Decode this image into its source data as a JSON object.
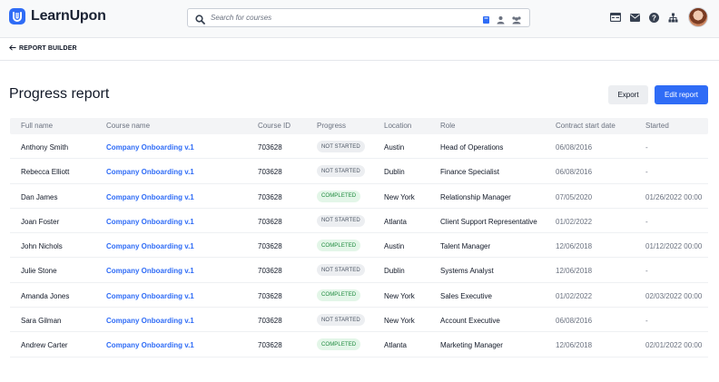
{
  "brand": {
    "name": "LearnUpon",
    "accent": "#2f6cf6"
  },
  "search": {
    "placeholder": "Search for courses",
    "value": "",
    "filter_icons": [
      "course-filter-icon",
      "user-filter-icon",
      "group-filter-icon"
    ]
  },
  "header_icons": [
    "catalog-icon",
    "mail-icon",
    "help-icon",
    "org-chart-icon",
    "avatar"
  ],
  "breadcrumb": {
    "back_label": "REPORT BUILDER"
  },
  "page": {
    "title": "Progress report",
    "export_label": "Export",
    "edit_label": "Edit report"
  },
  "table": {
    "columns": [
      "Full name",
      "Course name",
      "Course ID",
      "Progress",
      "Location",
      "Role",
      "Contract start date",
      "Started"
    ],
    "rows": [
      {
        "name": "Anthony Smith",
        "course": "Company Onboarding v.1",
        "id": "703628",
        "progress": "NOT STARTED",
        "status": "not",
        "location": "Austin",
        "role": "Head of Operations",
        "contract": "06/08/2016",
        "started": "-"
      },
      {
        "name": "Rebecca Elliott",
        "course": "Company Onboarding v.1",
        "id": "703628",
        "progress": "NOT STARTED",
        "status": "not",
        "location": "Dublin",
        "role": "Finance Specialist",
        "contract": "06/08/2016",
        "started": "-"
      },
      {
        "name": "Dan James",
        "course": "Company Onboarding v.1",
        "id": "703628",
        "progress": "COMPLETED",
        "status": "done",
        "location": "New York",
        "role": "Relationship Manager",
        "contract": "07/05/2020",
        "started": "01/26/2022 00:00"
      },
      {
        "name": "Joan Foster",
        "course": "Company Onboarding v.1",
        "id": "703628",
        "progress": "NOT STARTED",
        "status": "not",
        "location": "Atlanta",
        "role": "Client Support Representative",
        "contract": "01/02/2022",
        "started": "-"
      },
      {
        "name": "John Nichols",
        "course": "Company Onboarding v.1",
        "id": "703628",
        "progress": "COMPLETED",
        "status": "done",
        "location": "Austin",
        "role": "Talent Manager",
        "contract": "12/06/2018",
        "started": "01/12/2022 00:00"
      },
      {
        "name": "Julie Stone",
        "course": "Company Onboarding v.1",
        "id": "703628",
        "progress": "NOT STARTED",
        "status": "not",
        "location": "Dublin",
        "role": "Systems Analyst",
        "contract": "12/06/2018",
        "started": "-"
      },
      {
        "name": "Amanda Jones",
        "course": "Company Onboarding v.1",
        "id": "703628",
        "progress": "COMPLETED",
        "status": "done",
        "location": "New York",
        "role": "Sales Executive",
        "contract": "01/02/2022",
        "started": "02/03/2022 00:00"
      },
      {
        "name": "Sara Gilman",
        "course": "Company Onboarding v.1",
        "id": "703628",
        "progress": "NOT STARTED",
        "status": "not",
        "location": "New York",
        "role": "Account Executive",
        "contract": "06/08/2016",
        "started": "-"
      },
      {
        "name": "Andrew Carter",
        "course": "Company Onboarding v.1",
        "id": "703628",
        "progress": "COMPLETED",
        "status": "done",
        "location": "Atlanta",
        "role": "Marketing Manager",
        "contract": "12/06/2018",
        "started": "02/01/2022 00:00"
      }
    ]
  }
}
